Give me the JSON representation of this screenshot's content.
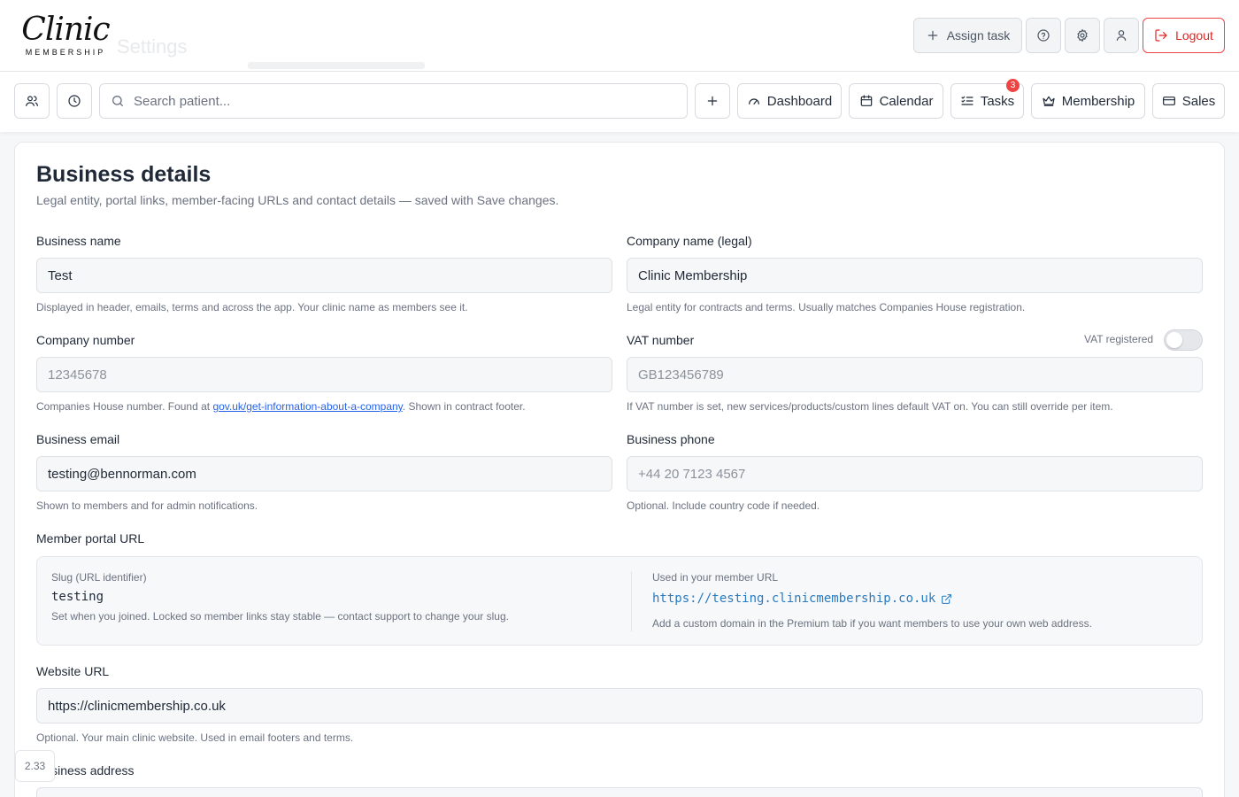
{
  "brand": {
    "logo_script": "Clinic",
    "logo_sub": "MEMBERSHIP"
  },
  "topbar": {
    "ghost_title": "Settings",
    "assign_task": "Assign task",
    "logout": "Logout"
  },
  "nav": {
    "search_placeholder": "Search patient...",
    "dashboard": "Dashboard",
    "calendar": "Calendar",
    "tasks": "Tasks",
    "tasks_badge": "3",
    "membership": "Membership",
    "sales": "Sales"
  },
  "card": {
    "title": "Business details",
    "description": "Legal entity, portal links, member-facing URLs and contact details — saved with Save changes."
  },
  "fields": {
    "business_name": {
      "label": "Business name",
      "value": "Test",
      "help": "Displayed in header, emails, terms and across the app. Your clinic name as members see it."
    },
    "company_name": {
      "label": "Company name (legal)",
      "value": "Clinic Membership",
      "help": "Legal entity for contracts and terms. Usually matches Companies House registration."
    },
    "company_number": {
      "label": "Company number",
      "placeholder": "12345678",
      "help_before": "Companies House number. Found at ",
      "help_link": "gov.uk/get-information-about-a-company",
      "help_after": ". Shown in contract footer."
    },
    "vat_number": {
      "label": "VAT number",
      "placeholder": "GB123456789",
      "toggle_label": "VAT registered",
      "vat_registered": false,
      "help": "If VAT number is set, new services/products/custom lines default VAT on. You can still override per item."
    },
    "business_email": {
      "label": "Business email",
      "value": "testing@bennorman.com",
      "help": "Shown to members and for admin notifications."
    },
    "business_phone": {
      "label": "Business phone",
      "placeholder": "+44 20 7123 4567",
      "help": "Optional. Include country code if needed."
    },
    "website_url": {
      "label": "Website URL",
      "value": "https://clinicmembership.co.uk",
      "help": "Optional. Your main clinic website. Used in email footers and terms."
    },
    "business_address": {
      "label": "Business address"
    }
  },
  "portal": {
    "label": "Member portal URL",
    "slug_caption": "Slug (URL identifier)",
    "slug": "testing",
    "slug_help": "Set when you joined. Locked so member links stay stable — contact support to change your slug.",
    "url_caption": "Used in your member URL",
    "url": "https://testing.clinicmembership.co.uk",
    "url_help": "Add a custom domain in the Premium tab if you want members to use your own web address."
  },
  "version": "2.33"
}
